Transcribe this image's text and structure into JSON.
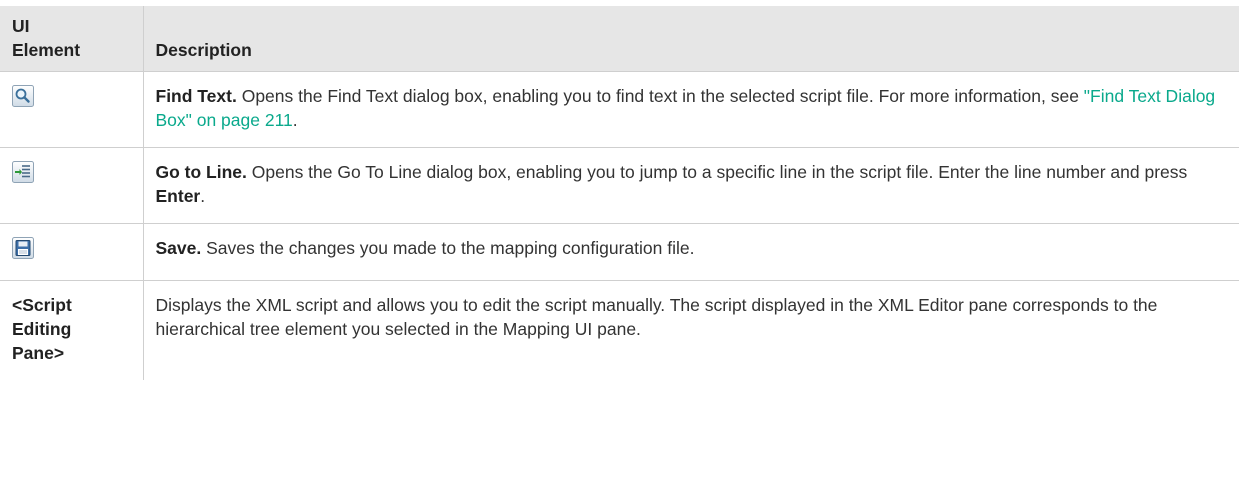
{
  "table": {
    "headers": {
      "col1_line1": "UI",
      "col1_line2": "Element",
      "col2": "Description"
    },
    "rows": [
      {
        "icon": "magnifier-icon",
        "title": "Find Text.",
        "text1": " Opens the Find Text dialog box, enabling you to find text in the selected script file. For more information, see ",
        "link": "\"Find Text Dialog Box\" on page 211",
        "text2": "."
      },
      {
        "icon": "go-to-line-icon",
        "title": "Go to Line.",
        "text1": " Opens the Go To Line dialog box, enabling you to jump to a specific line in the script file. Enter the line number and press ",
        "bold2": "Enter",
        "text2": "."
      },
      {
        "icon": "floppy-disk-icon",
        "title": "Save.",
        "text1": " Saves the changes you made to the mapping configuration file."
      },
      {
        "element_line1": "<Script",
        "element_line2": "Editing",
        "element_line3": "Pane>",
        "text": "Displays the XML script and allows you to edit the script manually. The script displayed in the XML Editor pane corresponds to the hierarchical tree element you selected in the Mapping UI pane."
      }
    ]
  },
  "colors": {
    "header_bg": "#e6e6e6",
    "border": "#cfcfcf",
    "link": "#0aa98c",
    "text": "#333333"
  }
}
